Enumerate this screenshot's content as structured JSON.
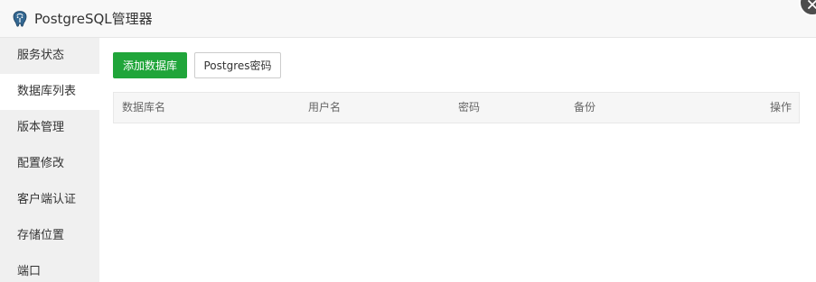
{
  "window": {
    "title": "PostgreSQL管理器",
    "icon": "postgresql-elephant-icon",
    "close_icon": "close-icon"
  },
  "sidebar": {
    "items": [
      {
        "label": "服务状态",
        "active": false
      },
      {
        "label": "数据库列表",
        "active": true
      },
      {
        "label": "版本管理",
        "active": false
      },
      {
        "label": "配置修改",
        "active": false
      },
      {
        "label": "客户端认证",
        "active": false
      },
      {
        "label": "存储位置",
        "active": false
      },
      {
        "label": "端口",
        "active": false
      }
    ]
  },
  "toolbar": {
    "add_database_label": "添加数据库",
    "postgres_password_label": "Postgres密码"
  },
  "table": {
    "columns": [
      "数据库名",
      "用户名",
      "密码",
      "备份",
      "操作"
    ],
    "rows": []
  },
  "colors": {
    "accent_green": "#20a53a",
    "sidebar_bg": "#f0f0f0",
    "header_bg": "#f6f6f6"
  }
}
